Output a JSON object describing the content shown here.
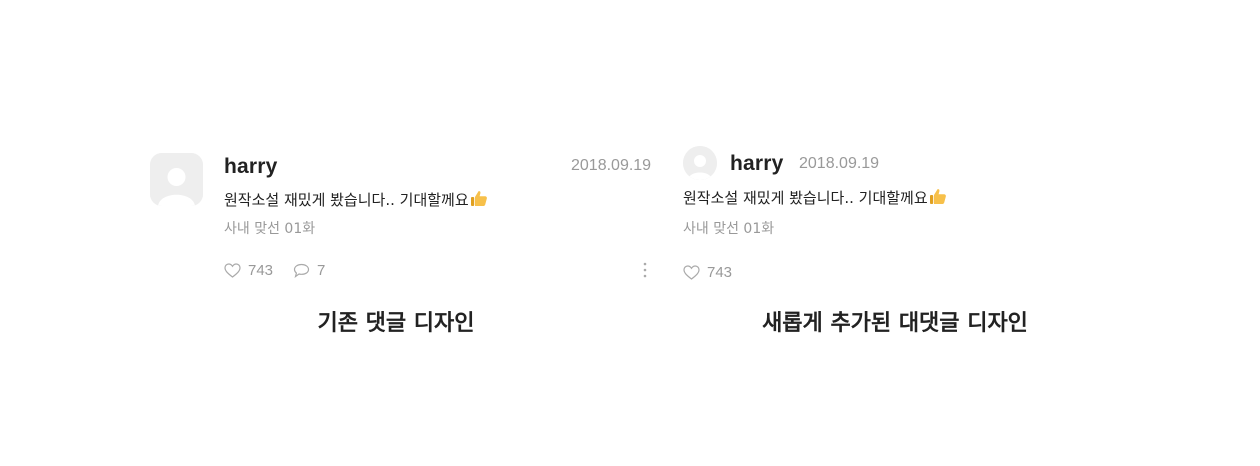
{
  "existing_comment": {
    "username": "harry",
    "date": "2018.09.19",
    "body": "원작소설 재밌게 봤습니다.. 기대할께요",
    "episode": "사내 맞선 01화",
    "likes": "743",
    "replies": "7",
    "caption": "기존 댓글 디자인"
  },
  "new_reply": {
    "username": "harry",
    "date": "2018.09.19",
    "body": "원작소설 재밌게 봤습니다.. 기대할께요",
    "episode": "사내 맞선 01화",
    "likes": "743",
    "caption": "새롭게 추가된 대댓글 디자인"
  },
  "icons": {
    "avatar": "user-avatar-icon",
    "thumbs_up": "thumbs-up-icon",
    "like": "heart-icon",
    "reply": "speech-bubble-icon",
    "more": "more-vertical-icon"
  },
  "colors": {
    "text": "#222222",
    "muted": "#999999",
    "avatar_bg": "#eeeeee",
    "thumb": "#f7c04a"
  }
}
